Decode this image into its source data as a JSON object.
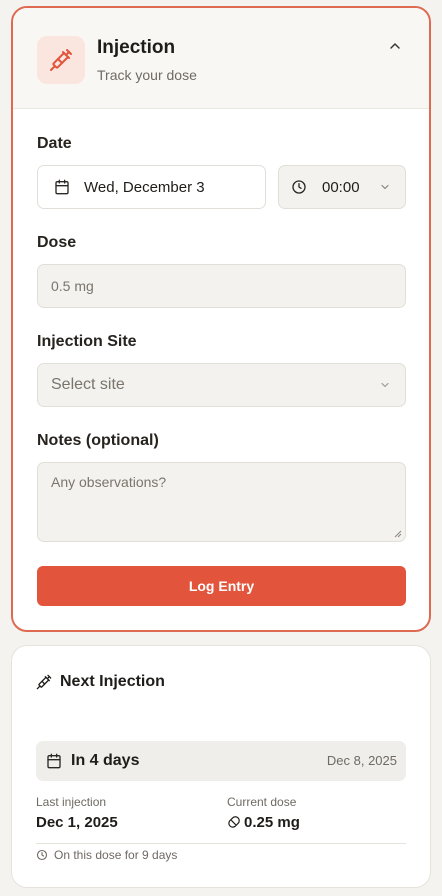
{
  "injection_card": {
    "title": "Injection",
    "subtitle": "Track your dose",
    "icon": "syringe-icon",
    "collapse_icon": "chevron-up-icon",
    "accent_color": "#e2553c",
    "date_label": "Date",
    "date_value": "Wed, December 3",
    "time_value": "00:00",
    "dose_label": "Dose",
    "dose_placeholder": "0.5 mg",
    "site_label": "Injection Site",
    "site_placeholder": "Select site",
    "notes_label": "Notes (optional)",
    "notes_placeholder": "Any observations?",
    "submit_label": "Log Entry"
  },
  "next_card": {
    "title": "Next Injection",
    "countdown": "In 4 days",
    "next_date": "Dec 8, 2025",
    "last_label": "Last injection",
    "last_value": "Dec 1, 2025",
    "dose_label": "Current dose",
    "dose_value": "0.25 mg",
    "footer": "On this dose for 9 days"
  }
}
